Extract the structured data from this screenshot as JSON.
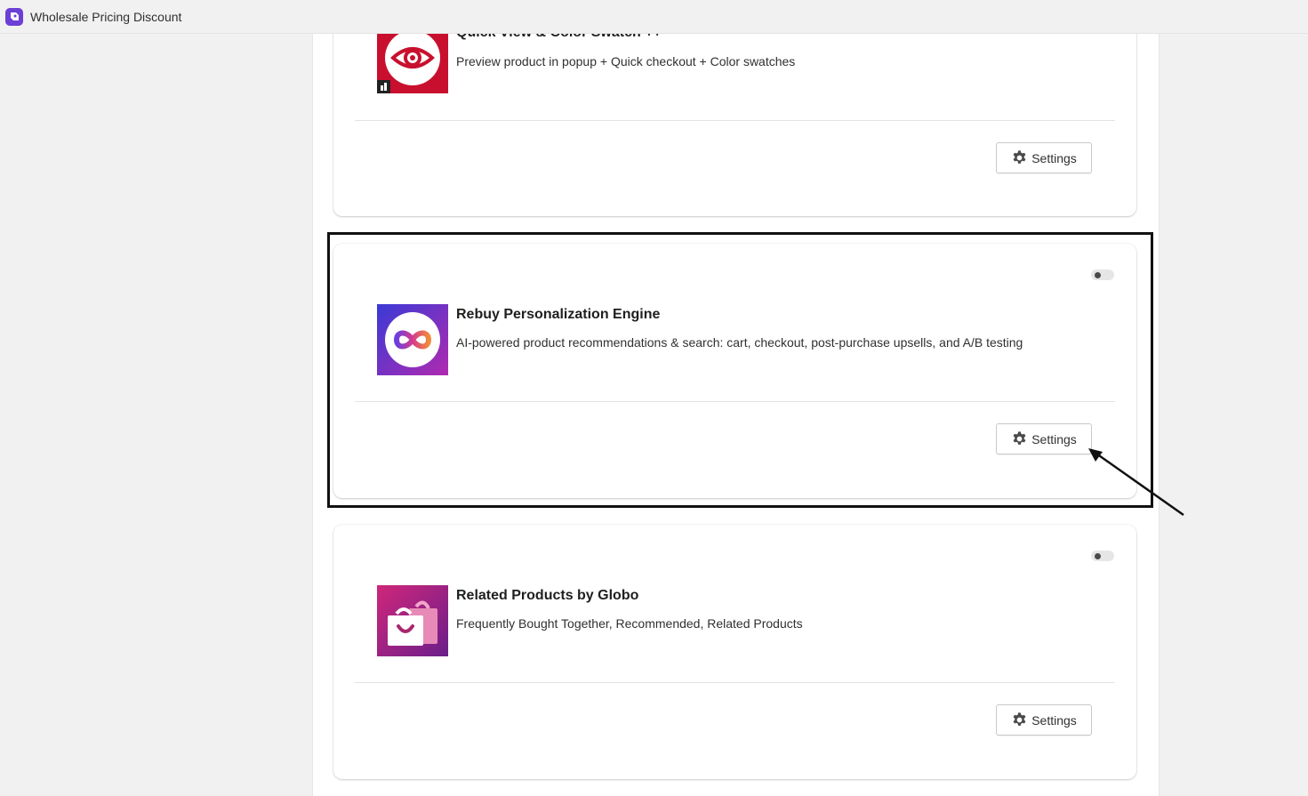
{
  "topbar": {
    "app_title": "Wholesale Pricing Discount",
    "logo_color": "#6c3fd6"
  },
  "apps": [
    {
      "name": "Quick View & Color Swatch ++",
      "description": "Preview product in popup + Quick checkout + Color swatches",
      "icon": "eye-icon",
      "settings_label": "Settings"
    },
    {
      "name": "Rebuy Personalization Engine",
      "description": "AI-powered product recommendations & search: cart, checkout, post-purchase upsells, and A/B testing",
      "icon": "infinity-icon",
      "settings_label": "Settings",
      "toggle_on": false,
      "highlighted": true
    },
    {
      "name": "Related Products by Globo",
      "description": "Frequently Bought Together, Recommended, Related Products",
      "icon": "shopping-bag-icon",
      "settings_label": "Settings",
      "toggle_on": false
    }
  ],
  "annotation": {
    "highlight_color": "#111111",
    "arrow_target": "rebuy-settings-button"
  }
}
